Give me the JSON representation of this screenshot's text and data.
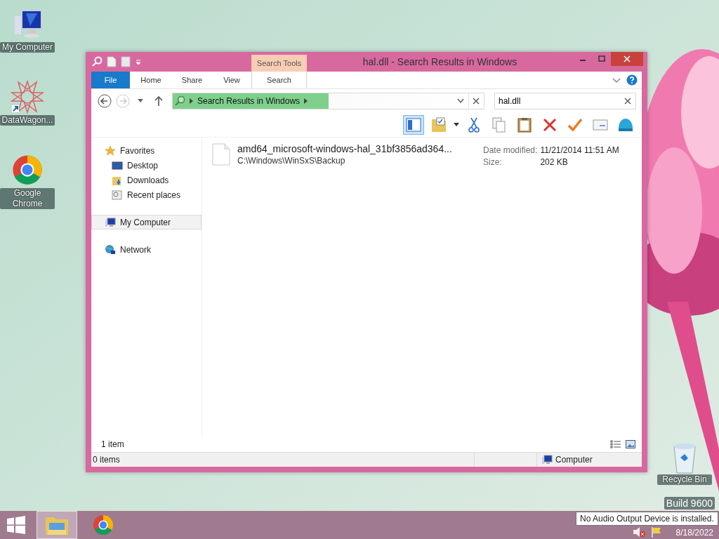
{
  "desktop_icons": [
    {
      "label": "My Computer",
      "kind": "computer"
    },
    {
      "label": "DataWagon...",
      "kind": "star"
    },
    {
      "label": "Google Chrome",
      "kind": "chrome"
    }
  ],
  "recycle_bin": {
    "label": "Recycle Bin"
  },
  "watermark": {
    "build": "Build 9600"
  },
  "window": {
    "title": "hal.dll - Search Results in Windows",
    "contextual_group": "Search Tools",
    "ribbon_tabs": [
      {
        "label": "File",
        "kind": "file"
      },
      {
        "label": "Home",
        "kind": "tab"
      },
      {
        "label": "Share",
        "kind": "tab"
      },
      {
        "label": "View",
        "kind": "tab"
      },
      {
        "label": "Search",
        "kind": "contextual"
      }
    ],
    "address": {
      "breadcrumb": "Search Results in Windows"
    },
    "search": {
      "value": "hal.dll"
    },
    "preview_pane": {
      "on": true
    },
    "nav": [
      {
        "label": "Favorites",
        "kind": "star",
        "selected": false,
        "children": [
          {
            "label": "Desktop",
            "kind": "desktop",
            "selected": false
          },
          {
            "label": "Downloads",
            "kind": "downloads",
            "selected": false
          },
          {
            "label": "Recent places",
            "kind": "recent",
            "selected": false
          }
        ]
      },
      {
        "label": "My Computer",
        "kind": "computer",
        "selected": true
      },
      {
        "label": "Network",
        "kind": "network",
        "selected": false
      }
    ],
    "results": [
      {
        "name": "amd64_microsoft-windows-hal_31bf3856ad364...",
        "path": "C:\\Windows\\WinSxS\\Backup",
        "date_label": "Date modified:",
        "date": "11/21/2014 11:51 AM",
        "size_label": "Size:",
        "size": "202 KB"
      }
    ],
    "item_count": "1 item",
    "status": {
      "selection": "0 items",
      "location": "Computer"
    }
  },
  "taskbar": {
    "items": [
      {
        "kind": "start",
        "selected": false
      },
      {
        "kind": "explorer",
        "selected": true
      },
      {
        "kind": "chrome",
        "selected": false
      }
    ],
    "date": "8/18/2022"
  },
  "tooltip": "No Audio Output Device is installed."
}
